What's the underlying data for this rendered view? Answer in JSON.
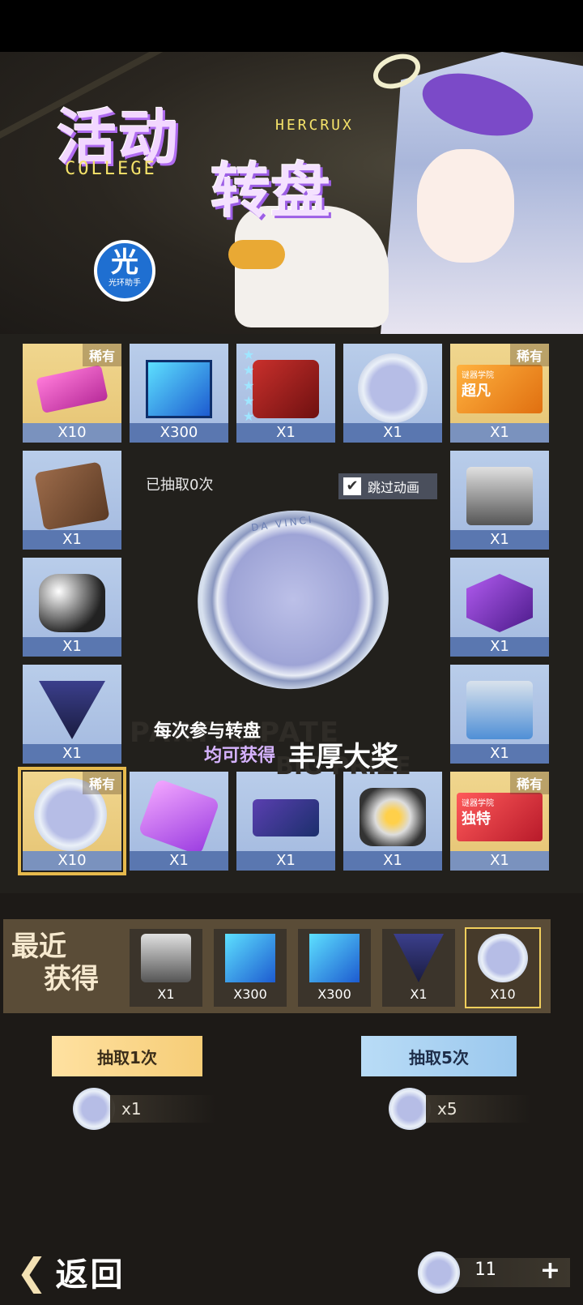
{
  "banner": {
    "title_line1": "活动",
    "title_line2": "转盘",
    "sub_left": "COLLEGE",
    "sub_right": "HERCRUX",
    "badge_glyph": "光",
    "badge_text": "光环助手"
  },
  "board": {
    "draw_count_text": "已抽取0次",
    "skip_label": "跳过动画",
    "skip_checked": true,
    "center_coin_text": "DA VINCI",
    "promo_line1": "每次参与转盘",
    "promo_line2": "均可获得",
    "promo_line3": "丰厚大奖",
    "bg_text1": "PARTICIPATE",
    "bg_text2": "BIG PRIZE",
    "rare_label": "稀有",
    "cells": [
      {
        "name": "gift-card",
        "qty": "X10",
        "rare": true
      },
      {
        "name": "cube-crystal",
        "qty": "X300",
        "rare": false
      },
      {
        "name": "mystery-box",
        "qty": "X1",
        "rare": false,
        "stars": 5
      },
      {
        "name": "da-vinci-coin",
        "qty": "X1",
        "rare": false
      },
      {
        "name": "ticket-orange",
        "qty": "X1",
        "rare": true,
        "ticket_small": "谜器学院",
        "ticket_big": "超凡"
      },
      {
        "name": "bronze-card",
        "qty": "X1",
        "rare": false
      },
      {
        "name": "red-core-box",
        "qty": "X1",
        "rare": false
      },
      {
        "name": "mecha-bunch",
        "qty": "X1",
        "rare": false
      },
      {
        "name": "purple-hex",
        "qty": "X1",
        "rare": false
      },
      {
        "name": "triangle-core",
        "qty": "X1",
        "rare": false
      },
      {
        "name": "blue-chest",
        "qty": "X1",
        "rare": false
      },
      {
        "name": "coin-selected",
        "qty": "X10",
        "rare": true,
        "selected": true
      },
      {
        "name": "purple-gem",
        "qty": "X1",
        "rare": false
      },
      {
        "name": "blue-card",
        "qty": "X1",
        "rare": false
      },
      {
        "name": "mecha-robot",
        "qty": "X1",
        "rare": false
      },
      {
        "name": "ticket-red",
        "qty": "X1",
        "rare": true,
        "ticket_small": "谜器学院",
        "ticket_big": "独特"
      }
    ]
  },
  "recent": {
    "label_line1": "最近",
    "label_line2": "获得",
    "items": [
      {
        "qty": "X1"
      },
      {
        "qty": "X300"
      },
      {
        "qty": "X300"
      },
      {
        "qty": "X1"
      },
      {
        "qty": "X10"
      }
    ]
  },
  "actions": {
    "draw_one": "抽取1次",
    "draw_five": "抽取5次",
    "cost_one": "x1",
    "cost_five": "x5"
  },
  "footer": {
    "back": "返回",
    "currency_amount": "11",
    "plus": "+"
  },
  "colors": {
    "rare_bg": "#f0d68e",
    "common_bg": "#b9cdea",
    "selected_outline": "#e6b94c"
  }
}
